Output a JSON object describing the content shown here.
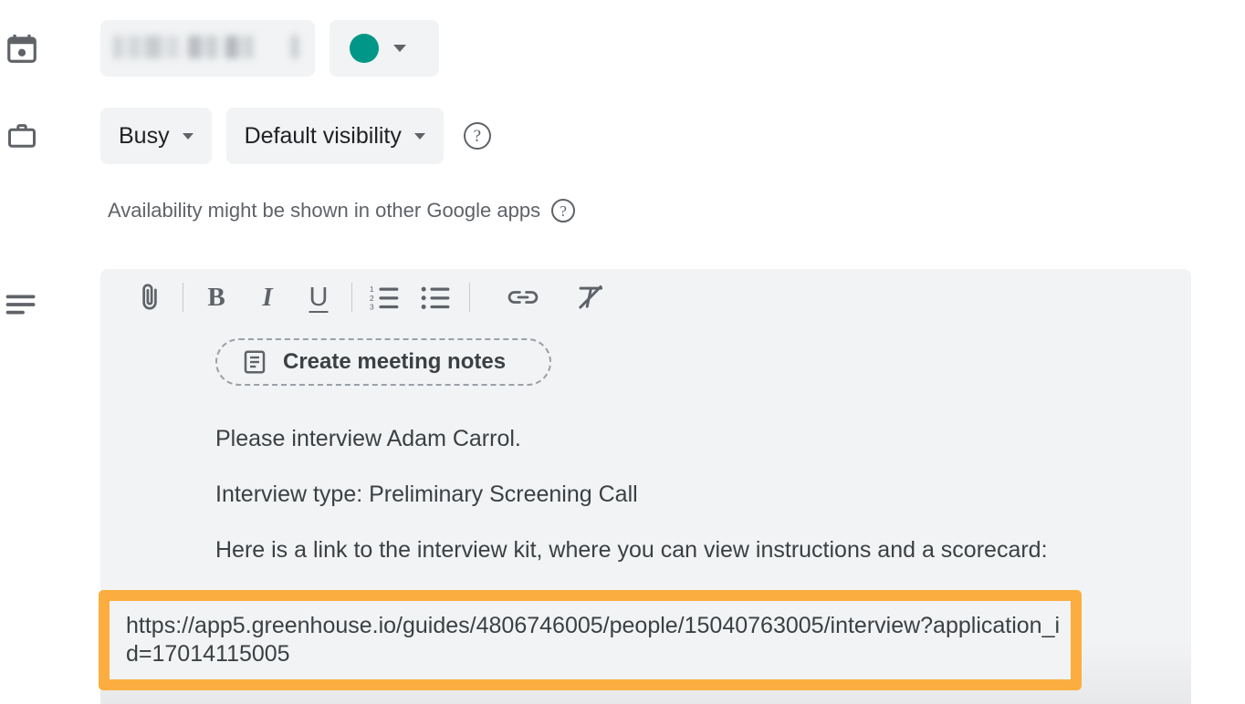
{
  "app": {
    "context": "google-calendar-event-editor"
  },
  "colors": {
    "panel_bg": "#f1f3f4",
    "page_bg": "#ffffff",
    "text_primary": "#3c4043",
    "text_secondary": "#5f6368",
    "event_color_swatch": "#009688",
    "highlight_border": "#fbae3f",
    "divider": "#c8ccd0"
  },
  "title_row": {
    "icon": "calendar-icon",
    "title_value": "",
    "title_redacted": true,
    "color_picker": {
      "icon": "color-swatch-icon",
      "swatch_color": "#009688",
      "caret": "chevron-down-icon"
    }
  },
  "availability_row": {
    "icon": "briefcase-icon",
    "busy_label": "Busy",
    "visibility_label": "Default visibility",
    "help_icon": "help-circle-icon",
    "help_glyph": "?"
  },
  "availability_note": {
    "text": "Availability might be shown in other Google apps",
    "help_icon": "help-circle-icon",
    "help_glyph": "?"
  },
  "description": {
    "gutter_icon": "description-lines-icon",
    "toolbar": [
      {
        "name": "attach-file-icon",
        "label": "",
        "type": "icon"
      },
      {
        "name": "toolbar-divider-1",
        "label": "",
        "type": "divider"
      },
      {
        "name": "bold-icon",
        "label": "B",
        "type": "text"
      },
      {
        "name": "italic-icon",
        "label": "I",
        "type": "text"
      },
      {
        "name": "underline-icon",
        "label": "U",
        "type": "text"
      },
      {
        "name": "toolbar-divider-2",
        "label": "",
        "type": "divider"
      },
      {
        "name": "numbered-list-icon",
        "label": "",
        "type": "icon"
      },
      {
        "name": "bulleted-list-icon",
        "label": "",
        "type": "icon"
      },
      {
        "name": "toolbar-divider-3",
        "label": "",
        "type": "divider"
      },
      {
        "name": "insert-link-icon",
        "label": "",
        "type": "icon"
      },
      {
        "name": "clear-formatting-icon",
        "label": "",
        "type": "icon"
      }
    ],
    "meeting_notes_button": {
      "icon": "document-icon",
      "label": "Create meeting notes"
    },
    "paragraphs": [
      "Please interview Adam Carrol.",
      "Interview type: Preliminary Screening Call",
      "Here is a link to the interview kit, where you can view instructions and a scorecard:"
    ],
    "link": {
      "url": "https://app5.greenhouse.io/guides/4806746005/people/15040763005/interview?application_id=17014115005",
      "highlighted": true
    }
  }
}
